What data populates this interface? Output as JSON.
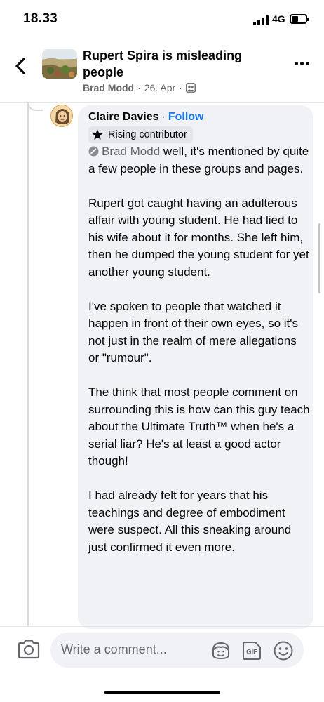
{
  "status_bar": {
    "time": "18.33",
    "network": "4G"
  },
  "header": {
    "title": "Rupert Spira is misleading people",
    "author": "Brad Modd",
    "separator": "·",
    "date": "26. Apr",
    "separator2": "·",
    "icons": {
      "back": "chevron-left-icon",
      "audience": "group-icon",
      "more": "more-dots-icon"
    }
  },
  "comment": {
    "author": "Claire Davies",
    "separator": "·",
    "follow_label": "Follow",
    "badge": {
      "label": "Rising contributor",
      "icon": "star-icon"
    },
    "mention": "Brad Modd",
    "paragraph_1": "well, it's mentioned by quite a few people in these groups and pages.",
    "paragraph_2": "Rupert got caught having an adulterous affair with young student. He had lied to his wife about it for months. She left him, then he dumped the young student for yet another young student.",
    "paragraph_3": "I've spoken to people that watched it happen in front of their own eyes, so it's not just in the realm of mere allegations or \"rumour\".",
    "paragraph_4": "The think that most people comment on surrounding this is how can this guy teach about the Ultimate Truth™ when he's a serial liar? He's at least a good actor though!",
    "paragraph_5": "I had already felt for years that his teachings and degree of embodiment were suspect. All this sneaking around just confirmed it even more."
  },
  "composer": {
    "placeholder": "Write a comment...",
    "icons": [
      "camera-icon",
      "avatar-sticker-icon",
      "gif-icon",
      "emoji-icon"
    ]
  },
  "colors": {
    "link_blue": "#1877f2",
    "secondary_text": "#65676b",
    "bubble_bg": "#f0f2f5"
  }
}
